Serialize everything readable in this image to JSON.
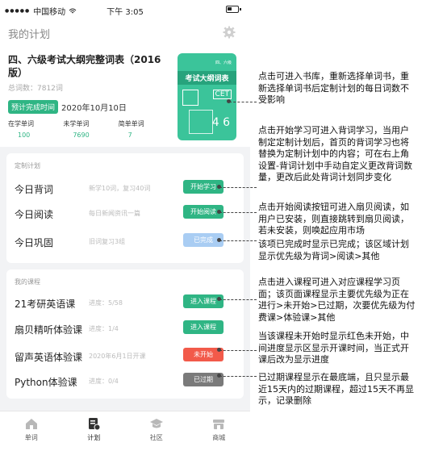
{
  "statusbar": {
    "carrier": "中国移动",
    "time": "下午 3:05"
  },
  "nav": {
    "title": "我的计划"
  },
  "book": {
    "title": "四、六级考试大纲完整词表（2016版）",
    "word_count": "总词数：7812词",
    "plan_badge": "预计完成时间",
    "plan_date": "2020年10月10日",
    "stats": [
      {
        "label": "在学单词",
        "value": "100"
      },
      {
        "label": "未学单词",
        "value": "7690"
      },
      {
        "label": "简单单词",
        "value": "7"
      }
    ],
    "cover": {
      "small": "四、六级",
      "title": "考试大纲词表",
      "cet": "CET",
      "num1": "4",
      "num2": "6"
    }
  },
  "plan": {
    "section": "定制计划",
    "rows": [
      {
        "name": "今日背词",
        "desc": "新学10词，复习40词",
        "button": "开始学习",
        "color": "#2fb584"
      },
      {
        "name": "今日阅读",
        "desc": "每日新闻资讯一篇",
        "button": "开始阅读",
        "color": "#2fb584"
      },
      {
        "name": "今日巩固",
        "desc": "旧词复习3组",
        "button": "已完成",
        "color": "#a9cdf3"
      }
    ]
  },
  "courses": {
    "section": "我的课程",
    "rows": [
      {
        "name": "21考研英语课",
        "desc": "进度：5/58",
        "button": "进入课程",
        "color": "#2fb584"
      },
      {
        "name": "扇贝精听体验课",
        "desc": "进度：1/4",
        "button": "进入课程",
        "color": "#2fb584"
      },
      {
        "name": "留声英语体验课",
        "desc": "2020年6月1日开课",
        "button": "未开始",
        "color": "#f25a4a"
      },
      {
        "name": "Python体验课",
        "desc": "进度：0/4",
        "button": "已过期",
        "color": "#7a7a7a"
      }
    ]
  },
  "tabs": [
    {
      "label": "单词",
      "icon": "home-icon"
    },
    {
      "label": "计划",
      "icon": "plan-icon"
    },
    {
      "label": "社区",
      "icon": "community-icon"
    },
    {
      "label": "商城",
      "icon": "shop-icon"
    }
  ],
  "notes": [
    "点击可进入书库，重新选择单词书，重新选择单词书后定制计划的每日词数不受影响",
    "点击开始学习可进入背词学习，当用户制定定制计划后，首页的背词学习也将替换为定制计划中的内容；可在右上角设置-背词计划中手动自定义更改背词数量，更改后此处背词计划同步变化",
    "点击开始阅读按钮可进入扇贝阅读，如用户已安装，则直接跳转到扇贝阅读，若未安装，则唤起应用市场",
    "该项已完成时显示已完成；该区域计划显示优先级为背词>阅读>其他",
    "点击进入课程可进入对应课程学习页面；该页面课程显示主要优先级为正在进行>未开始>已过期，次要优先级为付费课>体验课>其他",
    "当该课程未开始时显示红色未开始，中间进度显示区显示开课时间，当正式开课后改为显示进度",
    "已过期课程显示在最底端，且只显示最近15天内的过期课程，超过15天不再显示，记录删除"
  ]
}
